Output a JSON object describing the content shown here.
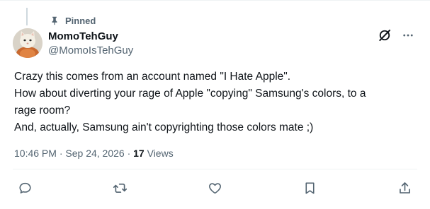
{
  "pinned": {
    "label": "Pinned",
    "icon": "pin-icon"
  },
  "author": {
    "display_name": "MomoTehGuy",
    "handle": "@MomoIsTehGuy",
    "avatar": "cat-avatar"
  },
  "header_actions": {
    "grok_icon": "grok-icon",
    "more_icon": "more-icon"
  },
  "tweet": {
    "lines": [
      "Crazy this comes from an account named \"I Hate Apple\".",
      "How about diverting your rage of Apple \"copying\" Samsung's colors, to a",
      "rage room?",
      "And, actually, Samsung ain't copyrighting those colors mate ;)"
    ]
  },
  "meta": {
    "time": "10:46 PM",
    "separator": "·",
    "date": "Sep 24, 2026",
    "views_count": "17",
    "views_label": "Views"
  },
  "actions": [
    {
      "name": "reply",
      "icon": "reply-icon"
    },
    {
      "name": "repost",
      "icon": "repost-icon"
    },
    {
      "name": "like",
      "icon": "heart-icon"
    },
    {
      "name": "bookmark",
      "icon": "bookmark-icon"
    },
    {
      "name": "share",
      "icon": "share-icon"
    }
  ],
  "colors": {
    "text_primary": "#0f1419",
    "text_secondary": "#536471",
    "border": "#eff3f4",
    "thread_line": "#cfd9de"
  }
}
